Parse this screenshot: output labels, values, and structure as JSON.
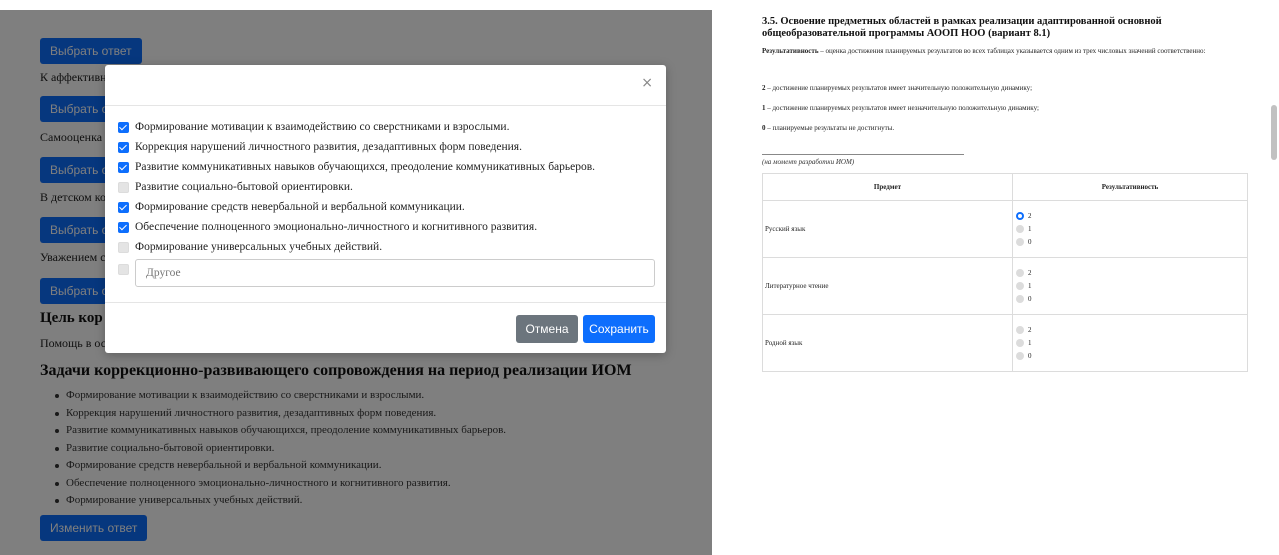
{
  "left": {
    "buttons": {
      "choose_answer": "Выбрать ответ",
      "change_answer": "Изменить ответ"
    },
    "texts": [
      "К аффективн",
      "Самооценка",
      "В детском ко",
      "Уважением с",
      "Помощь в ос"
    ],
    "goal_heading": "Цель кор",
    "tasks_heading": "Задачи коррекционно-развивающего сопровождения на период реализации ИОМ",
    "tasks": [
      "Формирование мотивации к взаимодействию со сверстниками и взрослыми.",
      "Коррекция нарушений личностного развития, дезадаптивных форм поведения.",
      "Развитие коммуникативных навыков обучающихся, преодоление коммуникативных барьеров.",
      "Развитие социально-бытовой ориентировки.",
      "Формирование средств невербальной и вербальной коммуникации.",
      "Обеспечение полноценного эмоционально-личностного и когнитивного развития.",
      "Формирование универсальных учебных действий."
    ]
  },
  "modal": {
    "close": "×",
    "options": [
      {
        "label": "Формирование мотивации к взаимодействию со сверстниками и взрослыми.",
        "checked": true
      },
      {
        "label": "Коррекция нарушений личностного развития, дезадаптивных форм поведения.",
        "checked": true
      },
      {
        "label": "Развитие коммуникативных навыков обучающихся, преодоление коммуникативных барьеров.",
        "checked": true
      },
      {
        "label": "Развитие социально-бытовой ориентировки.",
        "checked": false
      },
      {
        "label": "Формирование средств невербальной и вербальной коммуникации.",
        "checked": true
      },
      {
        "label": "Обеспечение полноценного эмоционально-личностного и когнитивного развития.",
        "checked": true
      },
      {
        "label": "Формирование универсальных учебных действий.",
        "checked": false
      }
    ],
    "other_checked": false,
    "other_placeholder": "Другое",
    "cancel": "Отмена",
    "save": "Сохранить"
  },
  "right": {
    "title": "3.5. Освоение предметных областей в рамках реализации адаптированной основной общеобразовательной программы АООП НОО (вариант 8.1)",
    "def_term": "Результативность",
    "def_text": " – оценка достижения планируемых результатов во всех таблицах указывается одним из трех числовых значений соответственно:",
    "levels": [
      {
        "num": "2",
        "text": " – достижение планируемых результатов имеет значительную положительную динамику;"
      },
      {
        "num": "1",
        "text": " – достижение планируемых результатов имеет незначительную положительную динамику;"
      },
      {
        "num": "0",
        "text": " – планируемые результаты не достигнуты."
      }
    ],
    "note": "(на момент разработки ИОМ)",
    "table_headers": [
      "Предмет",
      "Результативность"
    ],
    "rows": [
      {
        "subject": "Русский язык",
        "selected": "2"
      },
      {
        "subject": "Литературное чтение",
        "selected": null
      },
      {
        "subject": "Родной язык",
        "selected": null
      }
    ],
    "options": [
      "2",
      "1",
      "0"
    ]
  },
  "colors": {
    "primary": "#0d6efd",
    "secondary": "#6c757d",
    "backdrop": "rgba(0,0,0,0.5)"
  }
}
